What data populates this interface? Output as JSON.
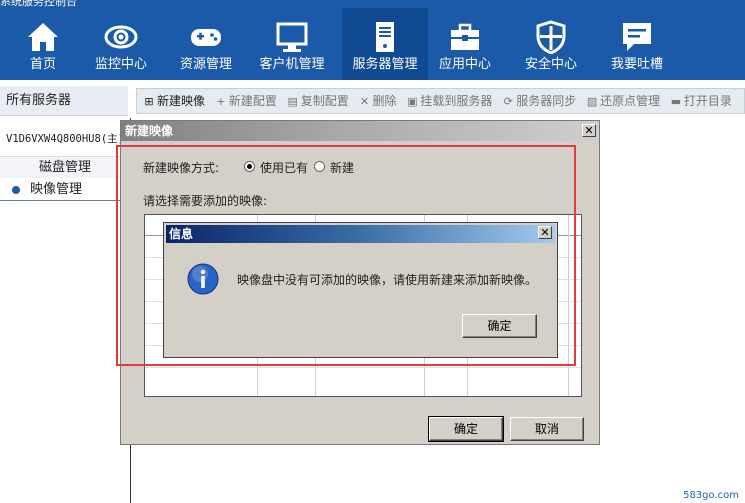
{
  "app": {
    "title": "系统服务控制台"
  },
  "nav": {
    "items": [
      {
        "label": "首页",
        "icon": "home-icon"
      },
      {
        "label": "监控中心",
        "icon": "eye-icon"
      },
      {
        "label": "资源管理",
        "icon": "gamepad-icon"
      },
      {
        "label": "客户机管理",
        "icon": "monitor-icon"
      },
      {
        "label": "服务器管理",
        "icon": "server-icon"
      },
      {
        "label": "应用中心",
        "icon": "toolbox-icon"
      },
      {
        "label": "安全中心",
        "icon": "shield-icon"
      },
      {
        "label": "我要吐槽",
        "icon": "feedback-icon"
      }
    ],
    "active_index": 4
  },
  "sidebar": {
    "title": "所有服务器",
    "server": "V1D6VXW4Q800HU8(主)",
    "sub_items": [
      "磁盘管理",
      "映像管理"
    ],
    "selected_index": 1
  },
  "toolbar": {
    "items": [
      {
        "label": "新建映像",
        "icon": "new-icon",
        "enabled": true
      },
      {
        "label": "新建配置",
        "icon": "plus-icon",
        "enabled": false
      },
      {
        "label": "复制配置",
        "icon": "copy-icon",
        "enabled": false
      },
      {
        "label": "删除",
        "icon": "delete-icon",
        "enabled": false
      },
      {
        "label": "挂载到服务器",
        "icon": "mount-icon",
        "enabled": false
      },
      {
        "label": "服务器同步",
        "icon": "sync-icon",
        "enabled": false
      },
      {
        "label": "还原点管理",
        "icon": "restore-icon",
        "enabled": false
      },
      {
        "label": "打开目录",
        "icon": "folder-icon",
        "enabled": false
      }
    ]
  },
  "dialog": {
    "title": "新建映像",
    "mode_label": "新建映像方式:",
    "options": [
      "使用已有",
      "新建"
    ],
    "selected_option": 0,
    "select_label": "请选择需要添加的映像:",
    "ok": "确定",
    "cancel": "取消"
  },
  "message": {
    "title": "信息",
    "text": "映像盘中没有可添加的映像，请使用新建来添加新映像。",
    "ok": "确定"
  },
  "watermark": "583go.com",
  "colors": {
    "nav_bg": "#1b5aa8",
    "highlight": "#e23b3b"
  }
}
